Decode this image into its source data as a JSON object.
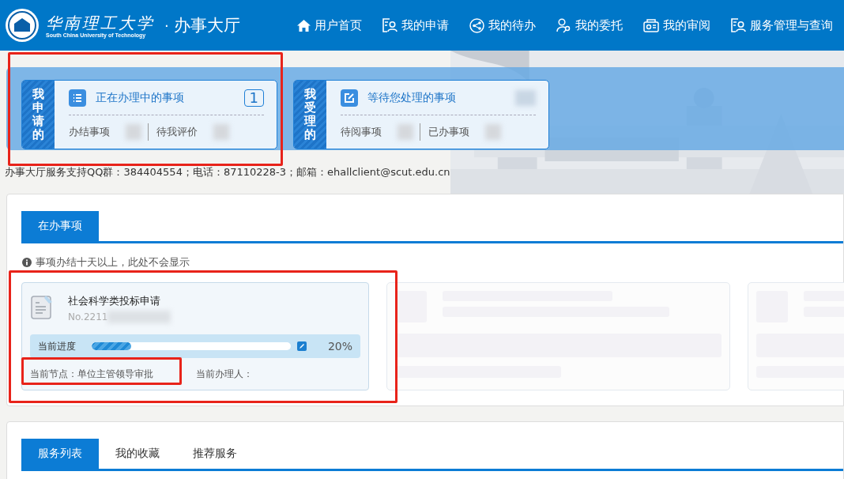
{
  "header": {
    "logo_text": "华南理工大学",
    "logo_subtitle": "South China University of Technology",
    "separator": "·",
    "title": "办事大厅",
    "nav": [
      {
        "label": "用户首页"
      },
      {
        "label": "我的申请"
      },
      {
        "label": "我的待办"
      },
      {
        "label": "我的委托"
      },
      {
        "label": "我的审阅"
      },
      {
        "label": "服务管理与查询"
      }
    ]
  },
  "summary_cards": [
    {
      "side_label": "我申请的",
      "title": "正在办理中的事项",
      "count": "1",
      "stats": [
        "办结事项",
        "待我评价"
      ]
    },
    {
      "side_label": "我受理的",
      "title": "等待您处理的事项",
      "stats": [
        "待阅事项",
        "已办事项"
      ]
    }
  ],
  "support_text": "办事大厅服务支持QQ群：384404554；电话：87110228-3；邮箱：ehallclient@scut.edu.cn",
  "tasks_panel": {
    "tabs": [
      {
        "label": "在办事项",
        "selected": true
      }
    ],
    "notice": "事项办结十天以上，此处不会显示",
    "items": [
      {
        "kind": "task",
        "title": "社会科学类投标申请",
        "number": "No.2211",
        "progress_label": "当前进度",
        "level": 0.2,
        "percent": "20%",
        "node": "当前节点：单位主管领导审批",
        "handler": "当前办理人："
      },
      {
        "kind": "skeleton"
      },
      {
        "kind": "skeleton"
      }
    ]
  },
  "services_panel": {
    "tabs": [
      {
        "label": "服务列表",
        "selected": true
      },
      {
        "label": "我的收藏",
        "selected": false
      },
      {
        "label": "推荐服务",
        "selected": false
      }
    ]
  }
}
